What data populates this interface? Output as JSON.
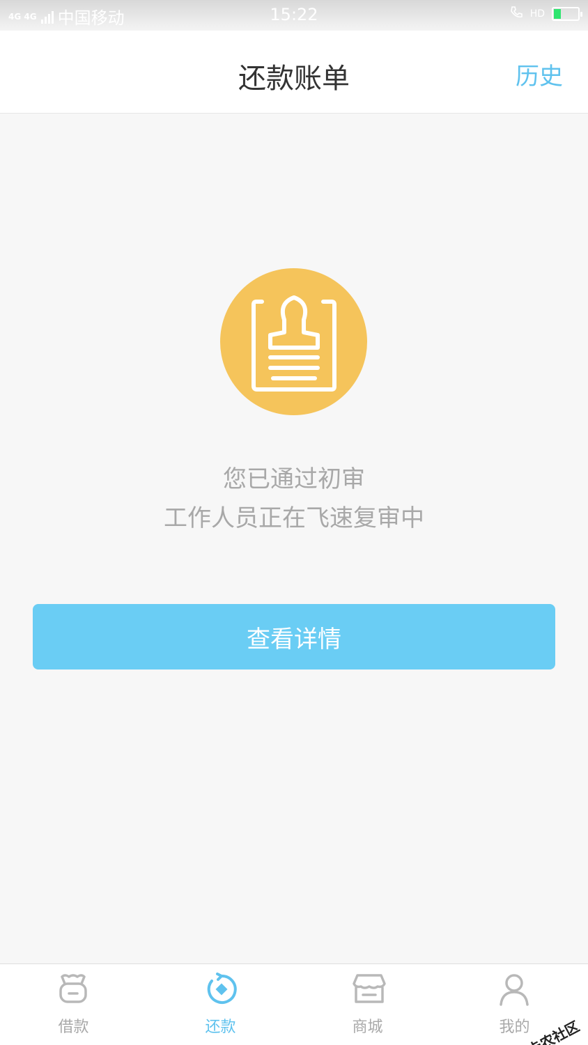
{
  "status_bar": {
    "network": "4G 4G",
    "carrier": "中国移动",
    "time": "15:22",
    "hd": "HD"
  },
  "header": {
    "title": "还款账单",
    "history_label": "历史"
  },
  "main": {
    "message_line1": "您已通过初审",
    "message_line2": "工作人员正在飞速复审中",
    "detail_button_label": "查看详情"
  },
  "tabs": [
    {
      "label": "借款",
      "icon": "bag-icon",
      "active": false
    },
    {
      "label": "还款",
      "icon": "repay-icon",
      "active": true
    },
    {
      "label": "商城",
      "icon": "store-icon",
      "active": false
    },
    {
      "label": "我的",
      "icon": "profile-icon",
      "active": false
    }
  ],
  "watermark": {
    "text": "卡农社区"
  },
  "colors": {
    "accent": "#5fc2ee",
    "button": "#6acdf4",
    "icon_circle": "#f5c45b",
    "background": "#f7f7f7"
  }
}
